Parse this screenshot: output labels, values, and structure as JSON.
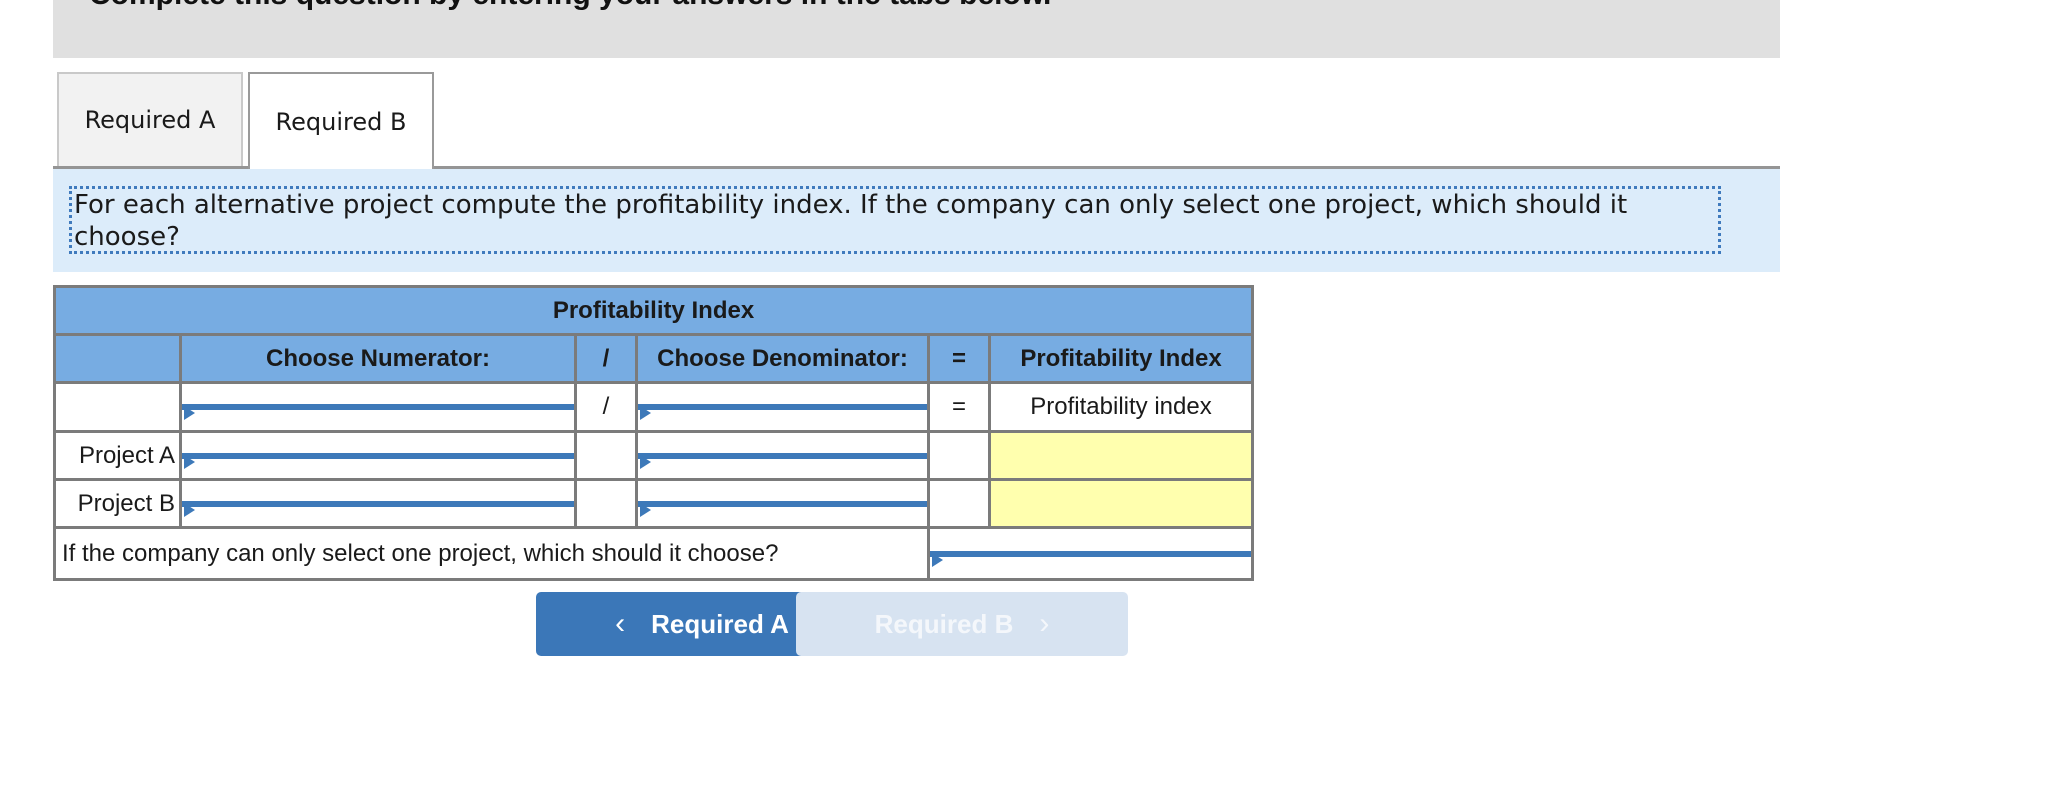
{
  "banner": {
    "text": "Complete this question by entering your answers in the tabs below."
  },
  "tabs": [
    {
      "label": "Required A",
      "active": false
    },
    {
      "label": "Required B",
      "active": true
    }
  ],
  "instruction": "For each alternative project compute the profitability index. If the company can only select one project, which should it choose?",
  "table": {
    "title": "Profitability Index",
    "headers": {
      "numerator": "Choose Numerator:",
      "divide": "/",
      "denominator": "Choose Denominator:",
      "equals": "=",
      "result": "Profitability Index"
    },
    "formula_row": {
      "label": "",
      "numerator": "",
      "divide": "/",
      "denominator": "",
      "equals": "=",
      "result": "Profitability index"
    },
    "rows": [
      {
        "label": "Project A",
        "numerator": "",
        "denominator": "",
        "result": ""
      },
      {
        "label": "Project B",
        "numerator": "",
        "denominator": "",
        "result": ""
      }
    ],
    "question": {
      "text": "If the company can only select one project, which should it choose?",
      "answer": ""
    }
  },
  "nav": {
    "prev": {
      "label": "Required A",
      "icon": "chevron-left-icon",
      "glyph": "‹",
      "enabled": true
    },
    "next": {
      "label": "Required B",
      "icon": "chevron-right-icon",
      "glyph": "›",
      "enabled": false
    }
  },
  "colors": {
    "header_bg": "#77ace2",
    "input_border": "#3d79b9",
    "result_bg": "#ffffae",
    "instruction_bg": "#dcecfa",
    "primary_button": "#3b77b8",
    "disabled_button": "#d7e3f1"
  }
}
